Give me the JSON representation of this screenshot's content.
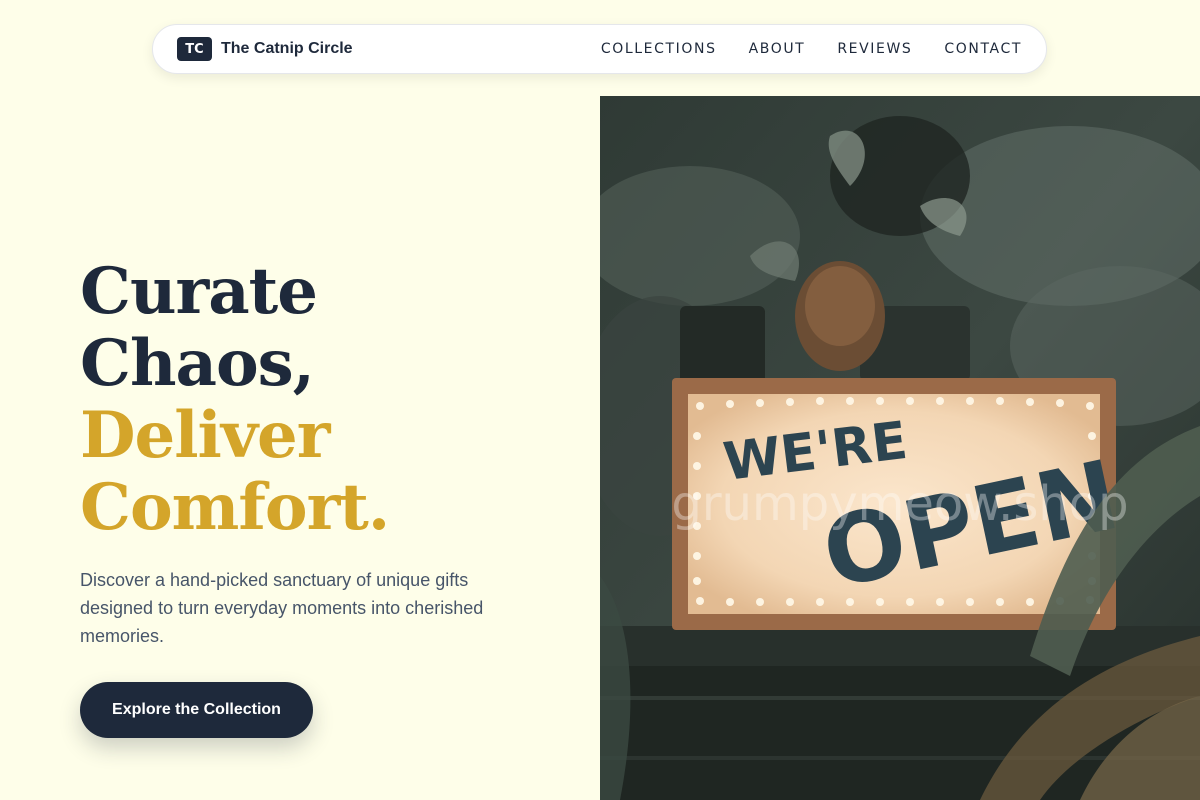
{
  "nav": {
    "logo_initials": "TC",
    "brand_name": "The Catnip Circle",
    "links": [
      "COLLECTIONS",
      "ABOUT",
      "REVIEWS",
      "CONTACT"
    ]
  },
  "hero": {
    "title_line1": "Curate",
    "title_line2": "Chaos,",
    "title_line3": "Deliver",
    "title_line4": "Comfort.",
    "description": "Discover a hand-picked sanctuary of unique gifts designed to turn everyday moments into cherished memories.",
    "cta_label": "Explore the Collection"
  },
  "photo": {
    "sign_line1": "WE'RE",
    "sign_line2": "OPEN",
    "watermark": "grumpymeow.shop"
  },
  "colors": {
    "background": "#fefee9",
    "navy": "#1e293b",
    "gold": "#d4a52a",
    "muted_text": "#475569"
  },
  "icons": [
    "logo-badge-icon"
  ]
}
